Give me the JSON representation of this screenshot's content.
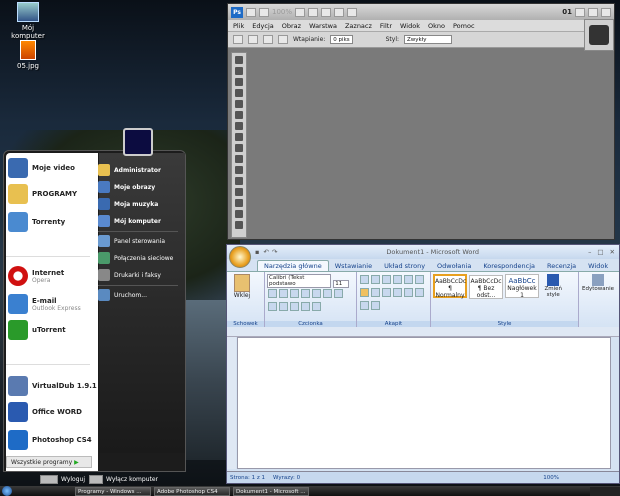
{
  "desktop": {
    "icons": [
      {
        "label": "Mój komputer",
        "icon": "computer-icon"
      },
      {
        "label": "05.jpg",
        "icon": "image-file-icon"
      }
    ]
  },
  "start_menu": {
    "pinned": [
      {
        "label": "Moje video",
        "icon": "video-icon"
      },
      {
        "label": "PROGRAMY",
        "icon": "folder-icon"
      },
      {
        "label": "Torrenty",
        "icon": "document-icon"
      },
      {
        "label": "Internet",
        "sub": "Opera",
        "icon": "opera-icon"
      },
      {
        "label": "E-mail",
        "sub": "Outlook Express",
        "icon": "email-icon"
      },
      {
        "label": "uTorrent",
        "icon": "utorrent-icon"
      },
      {
        "label": "VirtualDub 1.9.1",
        "icon": "virtualdub-icon"
      },
      {
        "label": "Office WORD",
        "icon": "word-icon"
      },
      {
        "label": "Photoshop CS4",
        "icon": "photoshop-icon"
      }
    ],
    "all_programs": "Wszystkie programy",
    "right": [
      {
        "label": "Administrator"
      },
      {
        "label": "Moje obrazy"
      },
      {
        "label": "Moja muzyka"
      },
      {
        "label": "Mój komputer"
      },
      {
        "label": "Panel sterowania"
      },
      {
        "label": "Połączenia sieciowe"
      },
      {
        "label": "Drukarki i faksy"
      },
      {
        "label": "Uruchom..."
      }
    ],
    "logoff": "Wyloguj",
    "shutdown": "Wyłącz komputer"
  },
  "photoshop": {
    "zoom": "100%",
    "doc_number": "01",
    "menu": [
      "Plik",
      "Edycja",
      "Obraz",
      "Warstwa",
      "Zaznacz",
      "Filtr",
      "Widok",
      "Okno",
      "Pomoc"
    ],
    "feather_label": "Wtapianie:",
    "feather_value": "0 piks",
    "style_label": "Styl:",
    "style_value": "Zwykły"
  },
  "word": {
    "title": "Dokument1 - Microsoft Word",
    "tabs": [
      "Narzędzia główne",
      "Wstawianie",
      "Układ strony",
      "Odwołania",
      "Korespondencja",
      "Recenzja",
      "Widok"
    ],
    "paste": "Wklej",
    "clipboard": "Schowek",
    "font_name": "Calibri (Tekst podstawo",
    "font_size": "11",
    "font_group": "Czcionka",
    "paragraph_group": "Akapit",
    "styles": [
      {
        "preview": "AaBbCcDc",
        "name": "¶ Normalny"
      },
      {
        "preview": "AaBbCcDc",
        "name": "¶ Bez odst..."
      },
      {
        "preview": "AaBbCc",
        "name": "Nagłówek 1"
      }
    ],
    "change_styles": "Zmień style",
    "styles_group": "Style",
    "editing": "Edytowanie",
    "status_page": "Strona: 1 z 1",
    "status_words": "Wyrazy: 0",
    "zoom": "100%"
  },
  "taskbar": {
    "items": [
      "Programy - Windows ...",
      "Adobe Photoshop CS4",
      "Dokument1 - Microsoft ..."
    ]
  }
}
